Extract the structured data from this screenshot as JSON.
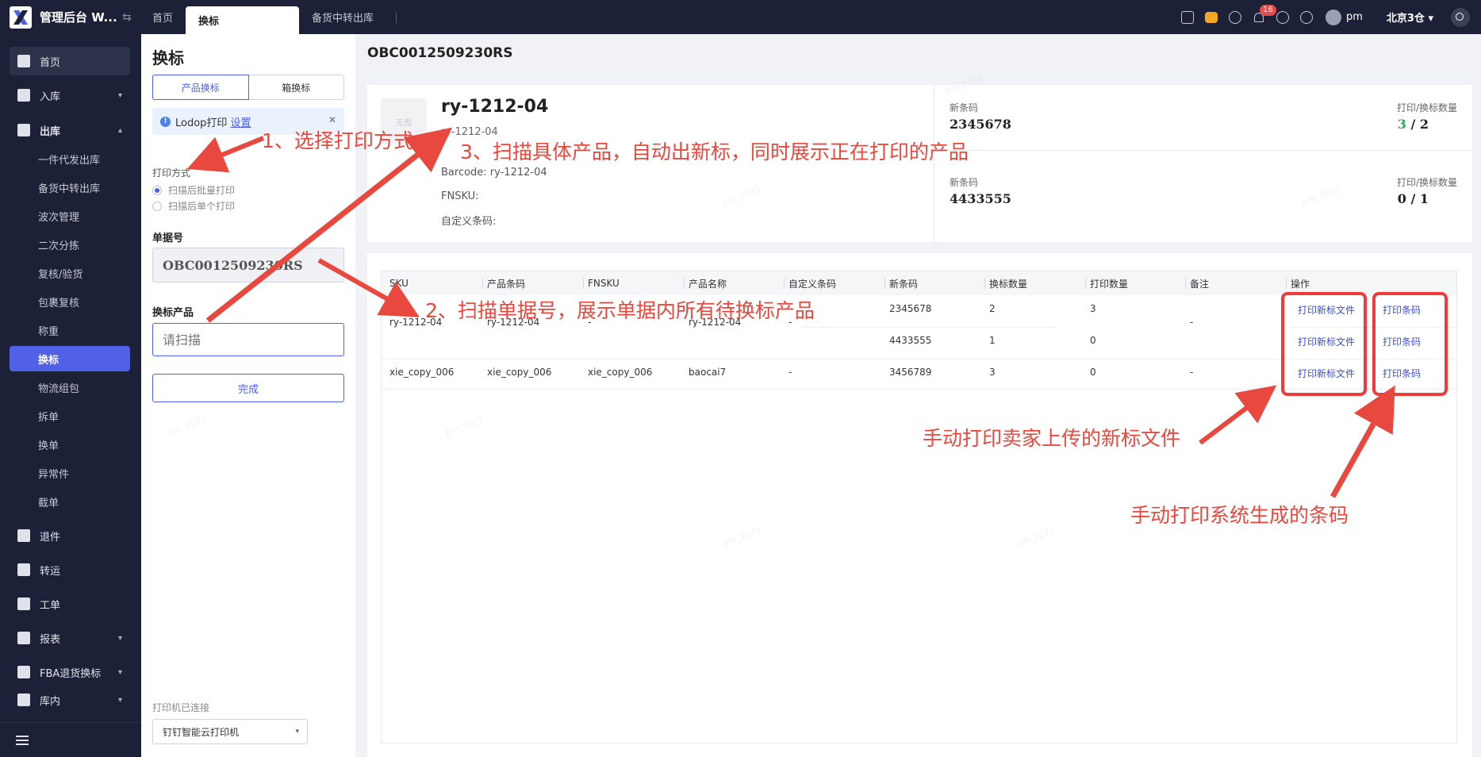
{
  "header": {
    "app_title": "管理后台 W...",
    "tabs": [
      {
        "label": "首页"
      },
      {
        "label": "换标"
      },
      {
        "label": "备货中转出库"
      }
    ],
    "notification_count": "16",
    "user_name": "pm",
    "warehouse": "北京3仓"
  },
  "sidebar": {
    "items": [
      {
        "label": "首页"
      },
      {
        "label": "入库"
      },
      {
        "label": "出库"
      },
      {
        "label": "退件"
      },
      {
        "label": "转运"
      },
      {
        "label": "工单"
      },
      {
        "label": "报表"
      },
      {
        "label": "FBA退货换标"
      },
      {
        "label": "库内"
      }
    ],
    "sub_items": [
      {
        "label": "一件代发出库"
      },
      {
        "label": "备货中转出库"
      },
      {
        "label": "波次管理"
      },
      {
        "label": "二次分拣"
      },
      {
        "label": "复核/验货"
      },
      {
        "label": "包裹复核"
      },
      {
        "label": "称重"
      },
      {
        "label": "换标"
      },
      {
        "label": "物流组包"
      },
      {
        "label": "拆单"
      },
      {
        "label": "换单"
      },
      {
        "label": "异常件"
      },
      {
        "label": "截单"
      }
    ]
  },
  "left_panel": {
    "title": "换标",
    "mode_tabs": [
      "产品换标",
      "箱换标"
    ],
    "notice_text": "Lodop打印",
    "notice_link": "设置",
    "print_mode_label": "打印方式",
    "print_options": [
      "扫描后批量打印",
      "扫描后单个打印"
    ],
    "order_label": "单据号",
    "order_value": "OBC0012509230RS",
    "scan_label": "换标产品",
    "scan_placeholder": "请扫描",
    "done_label": "完成",
    "printer_status": "打印机已连接",
    "printer_value": "钉钉智能云打印机"
  },
  "main": {
    "order_no": "OBC0012509230RS",
    "product": {
      "thumb_text": "无图",
      "name": "ry-1212-04",
      "sku": "ry-1212-04",
      "barcode_line": "Barcode: ry-1212-04",
      "fnsku_line": "FNSKU:",
      "custom_line": "自定义条码:"
    },
    "barcodes": [
      {
        "label": "新条码",
        "value": "2345678",
        "count_label": "打印/换标数量",
        "printed": "3",
        "total": "/ 2"
      },
      {
        "label": "新条码",
        "value": "4433555",
        "count_label": "打印/换标数量",
        "printed": "0",
        "total": "/ 1"
      }
    ],
    "table": {
      "headers": [
        "SKU",
        "产品条码",
        "FNSKU",
        "产品名称",
        "自定义条码",
        "新条码",
        "换标数量",
        "打印数量",
        "备注",
        "操作"
      ],
      "rows": [
        {
          "sku": "ry-1212-04",
          "product_barcode": "ry-1212-04",
          "fnsku": "-",
          "name": "ry-1212-04",
          "custom": "-",
          "remark": "-",
          "subs": [
            {
              "new_barcode": "2345678",
              "qty": "2",
              "printed": "3",
              "op1": "打印新标文件",
              "op2": "打印条码"
            },
            {
              "new_barcode": "4433555",
              "qty": "1",
              "printed": "0",
              "op1": "打印新标文件",
              "op2": "打印条码"
            }
          ]
        },
        {
          "sku": "xie_copy_006",
          "product_barcode": "xie_copy_006",
          "fnsku": "xie_copy_006",
          "name": "baocai7",
          "custom": "-",
          "remark": "-",
          "subs": [
            {
              "new_barcode": "3456789",
              "qty": "3",
              "printed": "0",
              "op1": "打印新标文件",
              "op2": "打印条码"
            }
          ]
        }
      ]
    }
  },
  "annotations": {
    "step1": "1、选择打印方式",
    "step2": "2、扫描单据号，展示单据内所有待换标产品",
    "step3": "3、扫描具体产品，自动出新标，同时展示正在打印的产品",
    "note_file": "手动打印卖家上传的新标文件",
    "note_barcode": "手动打印系统生成的条码"
  },
  "watermark": "pm_1071",
  "colors": {
    "accent": "#5061e7",
    "sidebar_bg": "#1c2137",
    "annotation_red": "#e8483e",
    "printed_green": "#2fa85c"
  }
}
